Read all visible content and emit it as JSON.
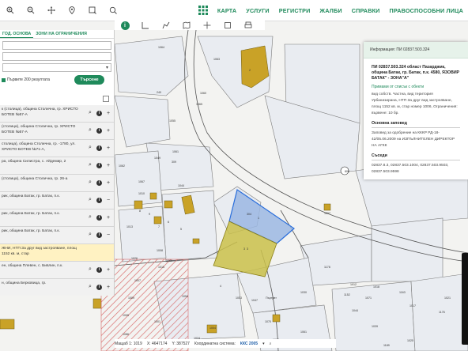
{
  "nav": {
    "items": [
      "КАРТА",
      "УСЛУГИ",
      "РЕГИСТРИ",
      "ЖАЛБИ",
      "СПРАВКИ",
      "ПРАВОСПОСОБНИ ЛИЦА"
    ]
  },
  "panel": {
    "tabs": [
      "ГОД. ОСНОВА",
      "ЗОНИ НА ОГРАНИЧЕНИЯ"
    ],
    "results_count_label": "Първите 200 резултата",
    "search_button": "Търсене",
    "results": [
      {
        "text": "к (столица), община Столична, гр. ХРИСТО БОТЕВ №57-А"
      },
      {
        "text": "(столица), община Столична, гр. ХРИСТО БОТЕВ №57-А"
      },
      {
        "text": "столица), община Столична, гр. -1780, ул. ХРИСТО БОТЕВ №71-А,"
      },
      {
        "text": "ра, община Силистра, с. Айдемир, 2"
      },
      {
        "text": "(столица), община Столична, гр. 26-а"
      },
      {
        "text": "рик, община Батак, гр. Батак, п.к."
      },
      {
        "text": "рик, община Батак, гр. Батак, п.к."
      },
      {
        "text": "рик, община Батак, гр. Батак, п.к."
      },
      {
        "text": "ЖНИ, НТП За друг вид застрояване, площ 1152 кв. м, стар",
        "highlight": true
      },
      {
        "text": "ен, община Плевен, с. Бивлин, п.к."
      },
      {
        "text": "н, община Берковица, гр."
      }
    ]
  },
  "info": {
    "header": "Информация: ПИ 02837.503.324",
    "title": "ПИ 02837.503.324 област Пазарджик, община Батак, гр. Батак, п.к. 4580, ЯЗОВИР БАТАК\" - ЗОНА\"А\"",
    "link": "Примами от списък с обекти",
    "desc": "вид собств. Частна, вид територия Урбанизирана, НТП За друг вид застрояване, площ 1152 кв. м, стар номер 1006, Ограничения: вървене: 10 бр.",
    "order_title": "Основна заповед",
    "order": "Заповед за одобрение на КККР РД-18-42/05.06.2009 на ИЗПЪЛНИТЕЛЕН ДИРЕКТОР НА АГКК",
    "neighbors_title": "Съседи",
    "neighbors": "02837.8.3,          02837.503.1004,          02837.503.9503, 02837.503.9598"
  },
  "status": {
    "scale": "Мащаб 1: 1019",
    "x": "X: 4647174",
    "y": "Y: 387527",
    "coord_label": "Координатна система:",
    "coord_system": "ККС 2005"
  },
  "map": {
    "labels": [
      "1064",
      "1063",
      "240",
      "1060",
      "1055",
      "1065",
      "1049",
      "1061",
      "1044",
      "1067",
      "1062",
      "309",
      "2",
      "3",
      "4",
      "5",
      "6",
      "7",
      "8",
      "9",
      "1013",
      "1010",
      "1008",
      "1069",
      "1015",
      "1026",
      "1007",
      "1009",
      "1005",
      "1001",
      "1003",
      "1047",
      "1054",
      "1004",
      "1178",
      "800",
      "1007",
      "1152",
      "1071",
      "1012",
      "1018",
      "1163",
      "1017",
      "1176",
      "1021",
      "1025",
      "1039",
      "1044",
      "1030",
      "1061",
      "1024",
      "1159",
      "1171",
      "1086",
      "304",
      "1070",
      "1000",
      "1189"
    ],
    "parcel_blue_label": "1",
    "parcel_yellow_label": "3",
    "road_label": "Пъртрвт"
  },
  "colors": {
    "accent": "#1f8a5b",
    "building": "#c9a227",
    "highlight_blue": "#9bb7e3",
    "highlight_yellow": "#c9c04a",
    "hatch": "#d86a6a"
  }
}
